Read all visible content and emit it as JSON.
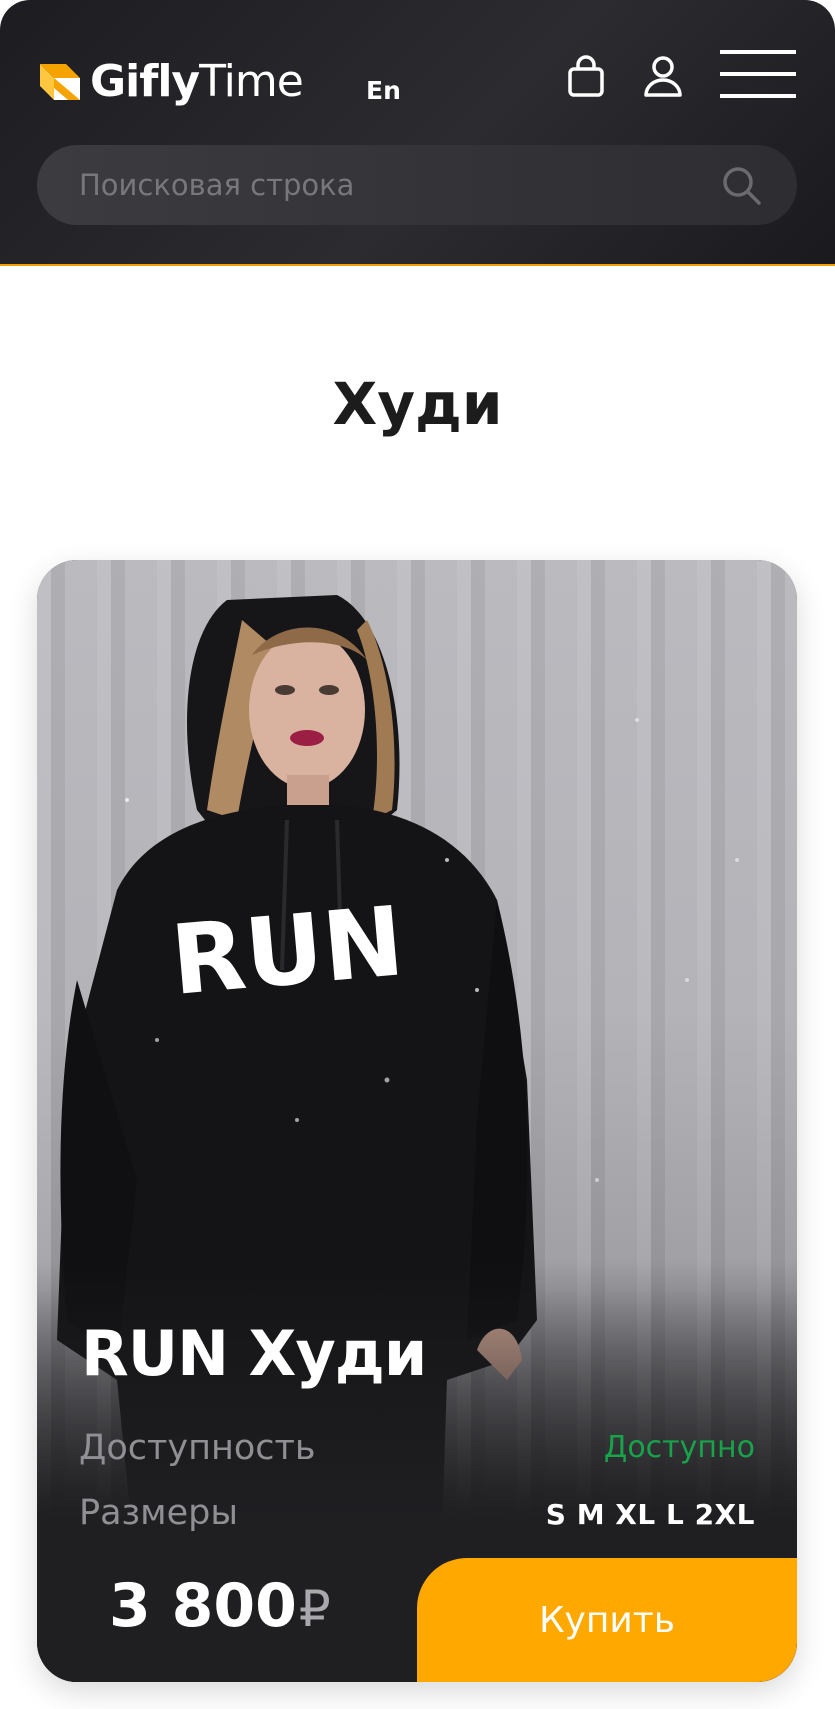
{
  "header": {
    "logo_bold": "Gifly",
    "logo_thin": "Time",
    "language": "En",
    "icons": [
      "bag-icon",
      "user-icon",
      "menu-icon"
    ]
  },
  "search": {
    "placeholder": "Поисковая строка",
    "value": ""
  },
  "page": {
    "title": "Худи"
  },
  "product": {
    "name": "RUN Худи",
    "availability_label": "Доступность",
    "availability_value": "Доступно",
    "sizes_label": "Размеры",
    "sizes_value": "S M XL L 2XL",
    "price": "3 800",
    "currency": "₽",
    "buy_label": "Купить",
    "print_text": "RUN"
  },
  "colors": {
    "accent": "#ffa800",
    "available": "#17a34a",
    "header_bg": "#1d1d21",
    "card_bg": "#1f1f22"
  }
}
